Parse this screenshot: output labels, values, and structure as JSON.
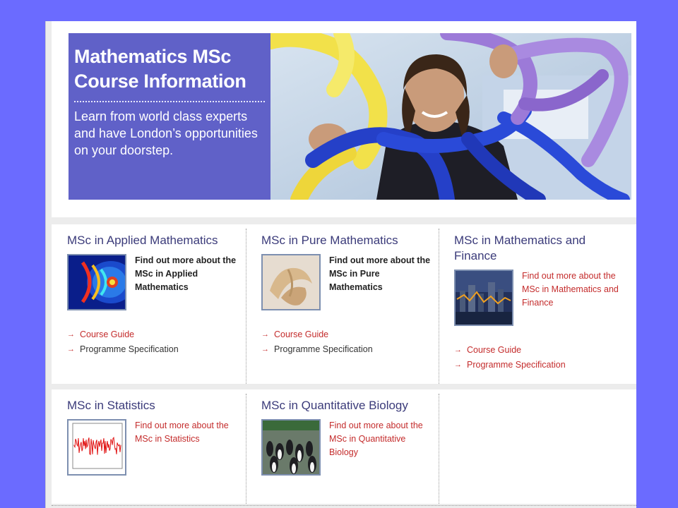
{
  "hero": {
    "title_line1": "Mathematics MSc",
    "title_line2": "Course Information",
    "subtitle": "Learn from world class experts and have London’s opportunities on your doorstep."
  },
  "cards": [
    {
      "title": "MSc in Applied Mathematics",
      "find_text": "Find out more about the MSc in Applied Mathematics",
      "links": [
        "Course Guide",
        "Programme Specification"
      ]
    },
    {
      "title": "MSc in Pure Mathematics",
      "find_text": "Find out more about the MSc in Pure Mathematics",
      "links": [
        "Course Guide",
        "Programme Specification"
      ]
    },
    {
      "title": "MSc in Mathematics and Finance",
      "find_text": "Find out more about the MSc in Mathematics and Finance",
      "links": [
        "Course Guide",
        "Programme Specification"
      ]
    },
    {
      "title": "MSc in Statistics",
      "find_text": "Find out more about the MSc in Statistics"
    },
    {
      "title": "MSc in Quantitative Biology",
      "find_text": "Find out more about the MSc in Quantitative Biology"
    }
  ],
  "icons": {
    "link_arrow": "arrow-right-icon"
  },
  "colors": {
    "background": "#6b6bff",
    "hero_panel": "#6061c8",
    "link_red": "#c42c2c",
    "title_blue": "#3b3b7a"
  }
}
